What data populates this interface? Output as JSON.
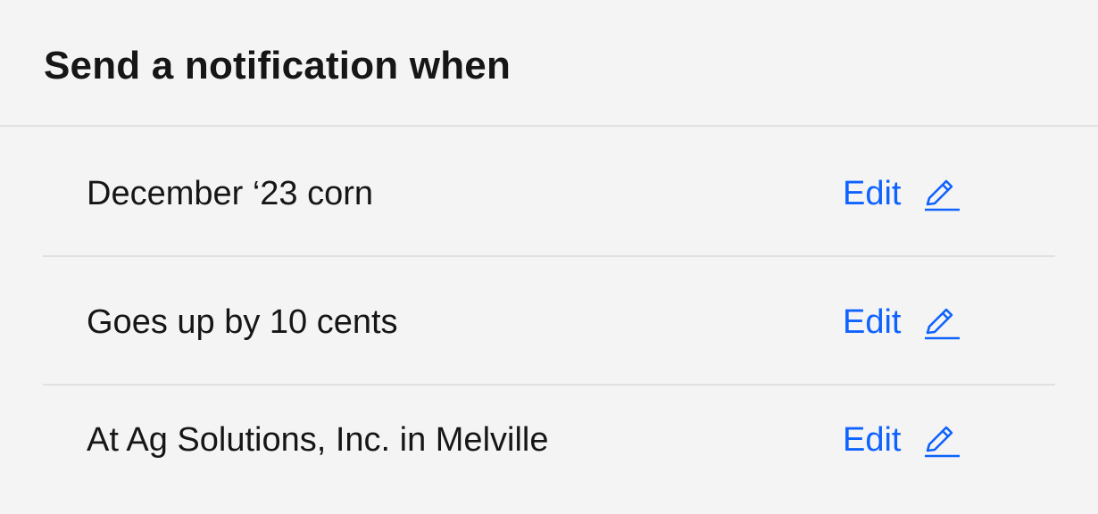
{
  "notification": {
    "title": "Send a notification when",
    "rows": [
      {
        "label": "December ‘23 corn",
        "action_label": "Edit",
        "icon": "pencil-icon"
      },
      {
        "label": "Goes up by 10 cents",
        "action_label": "Edit",
        "icon": "pencil-icon"
      },
      {
        "label": "At Ag Solutions, Inc. in Melville",
        "action_label": "Edit",
        "icon": "pencil-icon"
      }
    ]
  },
  "colors": {
    "background": "#f4f4f4",
    "text": "#161616",
    "link": "#0f62fe",
    "divider": "#e0e0e0"
  }
}
